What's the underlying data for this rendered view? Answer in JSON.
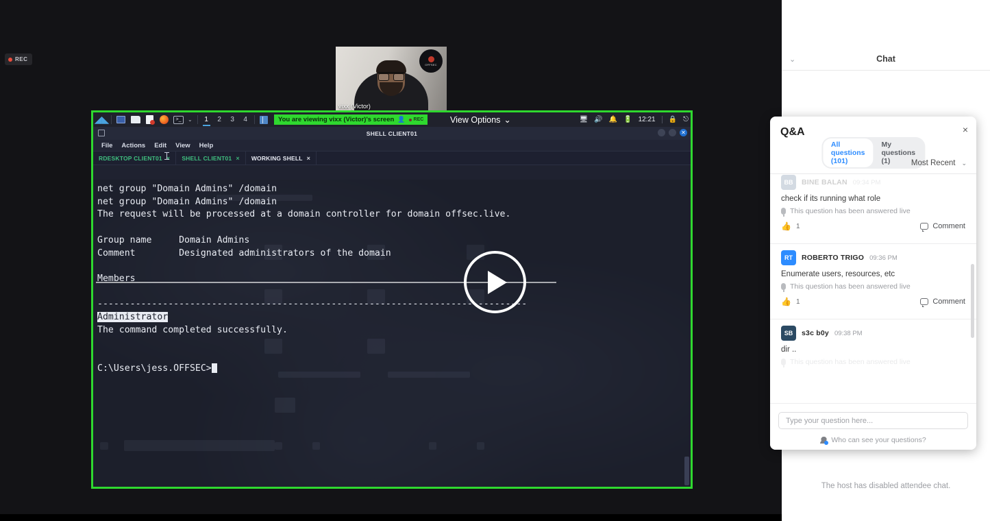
{
  "recorder": {
    "label": "REC"
  },
  "webcam": {
    "name": "vixx (Victor)",
    "logo_text": "OFFSEC"
  },
  "share": {
    "banner_text": "You are viewing vixx (Victor)'s screen",
    "banner_rec": "REC",
    "view_options": "View Options",
    "view_options_caret": "⌄"
  },
  "taskbar": {
    "workspaces": [
      "1",
      "2",
      "3",
      "4"
    ],
    "active_workspace": "1",
    "caret": "⌄"
  },
  "tray": {
    "clock": "12:21"
  },
  "terminal": {
    "window_title": "SHELL CLIENT01",
    "menu": [
      "File",
      "Actions",
      "Edit",
      "View",
      "Help"
    ],
    "tabs": [
      {
        "label": "RDESKTOP CLIENT01",
        "close": "×",
        "style": "green"
      },
      {
        "label": "SHELL CLIENT01",
        "close": "×",
        "style": "green"
      },
      {
        "label": "WORKING SHELL",
        "close": "×",
        "style": "white"
      }
    ],
    "lines": [
      "net group \"Domain Admins\" /domain",
      "net group \"Domain Admins\" /domain",
      "The request will be processed at a domain controller for domain offsec.live.",
      "",
      "Group name     Domain Admins",
      "Comment        Designated administrators of the domain",
      "",
      "Members",
      "",
      "-------------------------------------------------------------------------------"
    ],
    "selected_line": "Administrator",
    "after_selection": "The command completed successfully.",
    "prompt": "C:\\Users\\jess.OFFSEC>"
  },
  "chat": {
    "title": "Chat",
    "disabled_message": "The host has disabled attendee chat.",
    "collapse_caret": "⌄"
  },
  "qa": {
    "title": "Q&A",
    "close": "×",
    "tabs": [
      {
        "label": "All questions (101)",
        "active": true
      },
      {
        "label": "My questions (1)",
        "active": false
      }
    ],
    "sort": "Most Recent",
    "sort_caret": "⌄",
    "questions": [
      {
        "initials": "BB",
        "avatar_color": "#3d5a80",
        "author": "BINE BALAN",
        "time": "09:34 PM",
        "text": "check if its running what role",
        "answered": "This question has been answered live",
        "likes": "1",
        "comment": "Comment",
        "faded_header": true
      },
      {
        "initials": "RT",
        "avatar_color": "#2d8cff",
        "author": "ROBERTO TRIGO",
        "time": "09:36 PM",
        "text": "Enumerate users, resources, etc",
        "answered": "This question has been answered live",
        "likes": "1",
        "comment": "Comment",
        "faded_header": false
      },
      {
        "initials": "SB",
        "avatar_color": "#2b4a63",
        "author": "s3c b0y",
        "time": "09:38 PM",
        "text": "dir ..",
        "answered": "This question has been answered live",
        "likes": "",
        "comment": "",
        "faded_header": false
      }
    ],
    "input_placeholder": "Type your question here...",
    "who_can_see": "Who can see your questions?"
  },
  "colors": {
    "share_border_green": "#2fd82f",
    "accent_blue": "#2d8cff",
    "terminal_bg": "#1c1f2b"
  }
}
